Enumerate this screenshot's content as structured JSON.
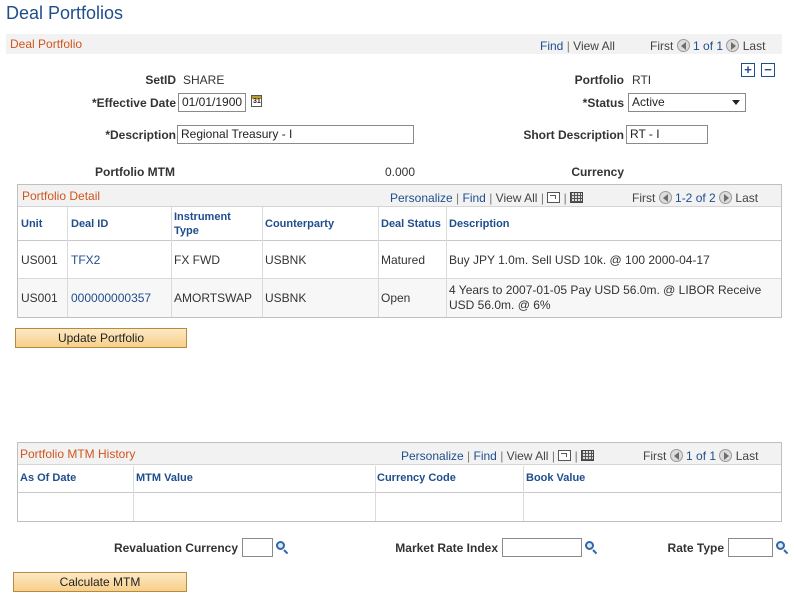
{
  "page": {
    "title": "Deal Portfolios"
  },
  "deal_portfolio": {
    "title": "Deal Portfolio",
    "nav": {
      "find": "Find",
      "view_all": "View All",
      "first": "First",
      "range": "1 of 1",
      "last": "Last"
    },
    "setid_label": "SetID",
    "setid_value": "SHARE",
    "portfolio_label": "Portfolio",
    "portfolio_value": "RTI",
    "effective_date_label": "*Effective Date",
    "effective_date_value": "01/01/1900",
    "status_label": "*Status",
    "status_value": "Active",
    "description_label": "*Description",
    "description_value": "Regional Treasury - I",
    "short_description_label": "Short Description",
    "short_description_value": "RT - I",
    "portfolio_mtm_label": "Portfolio MTM",
    "portfolio_mtm_value": "0.000",
    "currency_label": "Currency"
  },
  "portfolio_detail": {
    "title": "Portfolio Detail",
    "nav": {
      "personalize": "Personalize",
      "find": "Find",
      "view_all": "View All",
      "first": "First",
      "range": "1-2 of 2",
      "last": "Last"
    },
    "columns": [
      "Unit",
      "Deal ID",
      "Instrument Type",
      "Counterparty",
      "Deal Status",
      "Description"
    ],
    "instrument_type_line1": "Instrument",
    "instrument_type_line2": "Type",
    "rows": [
      {
        "unit": "US001",
        "deal_id": "TFX2",
        "instrument_type": "FX FWD",
        "counterparty": "USBNK",
        "deal_status": "Matured",
        "description": "Buy JPY 1.0m. Sell USD 10k. @ 100 2000-04-17"
      },
      {
        "unit": "US001",
        "deal_id": "000000000357",
        "instrument_type": "AMORTSWAP",
        "counterparty": "USBNK",
        "deal_status": "Open",
        "description_line1": "4 Years to 2007-01-05 Pay USD 56.0m. @ LIBOR Receive",
        "description_line2": "USD 56.0m. @ 6%"
      }
    ]
  },
  "update_button": "Update Portfolio",
  "mtm_history": {
    "title": "Portfolio MTM History",
    "nav": {
      "personalize": "Personalize",
      "find": "Find",
      "view_all": "View All",
      "first": "First",
      "range": "1 of 1",
      "last": "Last"
    },
    "columns": [
      "As Of Date",
      "MTM Value",
      "Currency Code",
      "Book Value"
    ]
  },
  "revaluation": {
    "revaluation_currency_label": "Revaluation Currency",
    "market_rate_index_label": "Market Rate Index",
    "rate_type_label": "Rate Type"
  },
  "calculate_button": "Calculate MTM"
}
